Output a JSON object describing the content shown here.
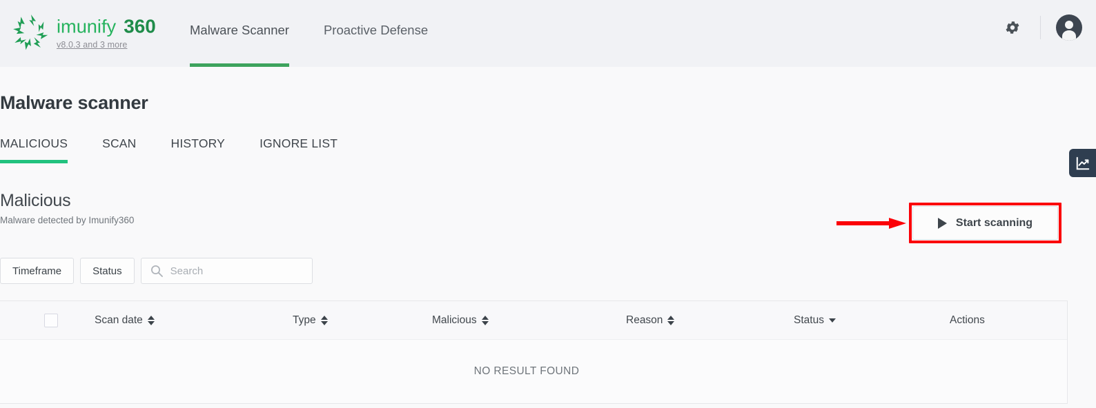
{
  "header": {
    "brand_name": "imunify360",
    "version_link": "v8.0.3 and 3 more",
    "nav_tabs": [
      {
        "label": "Malware Scanner",
        "active": true
      },
      {
        "label": "Proactive Defense",
        "active": false
      }
    ],
    "gear_icon": "gear-icon",
    "avatar_icon": "user-avatar-icon"
  },
  "page": {
    "title": "Malware scanner",
    "sub_tabs": [
      {
        "label": "MALICIOUS",
        "active": true
      },
      {
        "label": "SCAN",
        "active": false
      },
      {
        "label": "HISTORY",
        "active": false
      },
      {
        "label": "IGNORE LIST",
        "active": false
      }
    ]
  },
  "section": {
    "title": "Malicious",
    "subtitle": "Malware detected by Imunify360"
  },
  "actions": {
    "start_scanning_label": "Start scanning",
    "play_icon": "play-icon"
  },
  "filters": {
    "timeframe_label": "Timeframe",
    "status_label": "Status",
    "search_placeholder": "Search",
    "search_value": "",
    "search_icon": "search-icon"
  },
  "table": {
    "columns": [
      {
        "label": "Scan date",
        "sort": "both"
      },
      {
        "label": "Type",
        "sort": "both"
      },
      {
        "label": "Malicious",
        "sort": "both"
      },
      {
        "label": "Reason",
        "sort": "both"
      },
      {
        "label": "Status",
        "sort": "down"
      },
      {
        "label": "Actions",
        "sort": "none"
      }
    ],
    "empty_message": "NO RESULT FOUND"
  },
  "side_widget": {
    "icon": "trending-chart-icon"
  },
  "annotation": {
    "highlight_color": "#fb0007",
    "arrow_color": "#fb0007"
  },
  "colors": {
    "header_bg": "#f1f2f5",
    "page_bg": "#f9f9fa",
    "brand_green": "#1f9e55",
    "nav_underline": "#3da35d",
    "tab_underline": "#21c27e",
    "widget_bg": "#2f3e50"
  }
}
